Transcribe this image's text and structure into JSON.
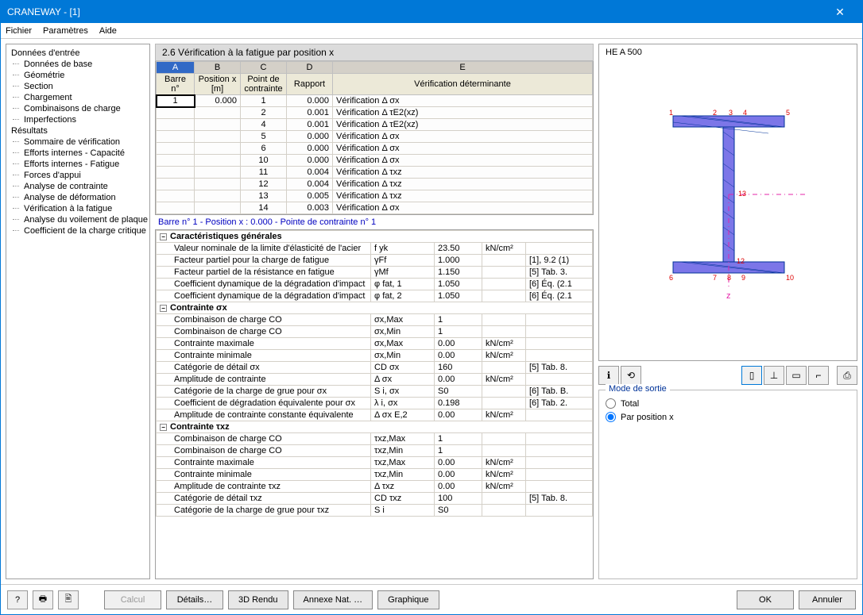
{
  "window_title": "CRANEWAY - [1]",
  "menu": {
    "file": "Fichier",
    "params": "Paramètres",
    "help": "Aide"
  },
  "sidebar": {
    "group1": "Données d'entrée",
    "items1": [
      "Données de base",
      "Géométrie",
      "Section",
      "Chargement",
      "Combinaisons de charge",
      "Imperfections"
    ],
    "group2": "Résultats",
    "items2": [
      "Sommaire de vérification",
      "Efforts internes - Capacité",
      "Efforts internes - Fatigue",
      "Forces d'appui",
      "Analyse de contrainte",
      "Analyse de déformation",
      "Vérification à la fatigue",
      "Analyse du voilement de plaque",
      "Coefficient de la charge critique"
    ]
  },
  "panel_title": "2.6 Vérification à la fatigue par position x",
  "headers": {
    "colA": "A",
    "colB": "B",
    "colC": "C",
    "colD": "D",
    "colE": "E",
    "barre": "Barre n°",
    "pos": "Position x [m]",
    "pt": "Point de contrainte",
    "ratio": "Rapport",
    "det": "Vérification déterminante"
  },
  "rows": [
    {
      "b": "1",
      "x": "0.000",
      "pt": "1",
      "r": "0.000",
      "d": "Vérification  Δ σx"
    },
    {
      "b": "",
      "x": "",
      "pt": "2",
      "r": "0.001",
      "d": "Vérification  Δ τE2(xz)"
    },
    {
      "b": "",
      "x": "",
      "pt": "4",
      "r": "0.001",
      "d": "Vérification  Δ τE2(xz)"
    },
    {
      "b": "",
      "x": "",
      "pt": "5",
      "r": "0.000",
      "d": "Vérification  Δ σx"
    },
    {
      "b": "",
      "x": "",
      "pt": "6",
      "r": "0.000",
      "d": "Vérification  Δ σx"
    },
    {
      "b": "",
      "x": "",
      "pt": "10",
      "r": "0.000",
      "d": "Vérification  Δ σx"
    },
    {
      "b": "",
      "x": "",
      "pt": "11",
      "r": "0.004",
      "d": "Vérification  Δ τxz"
    },
    {
      "b": "",
      "x": "",
      "pt": "12",
      "r": "0.004",
      "d": "Vérification  Δ τxz"
    },
    {
      "b": "",
      "x": "",
      "pt": "13",
      "r": "0.005",
      "d": "Vérification  Δ τxz"
    },
    {
      "b": "",
      "x": "",
      "pt": "14",
      "r": "0.003",
      "d": "Vérification  Δ σx"
    }
  ],
  "detail_label": "Barre n°  1  -  Position x :  0.000  -  Pointe de contrainte n°  1",
  "detail_groups": {
    "g1": "Caractéristiques générales",
    "g2": "Contrainte σx",
    "g3": "Contrainte τxz"
  },
  "details": [
    {
      "lbl": "Valeur nominale de la limite d'élasticité de l'acier",
      "sym": "f yk",
      "val": "23.50",
      "unit": "kN/cm²",
      "ref": ""
    },
    {
      "lbl": "Facteur partiel pour la charge de fatigue",
      "sym": "γFf",
      "val": "1.000",
      "unit": "",
      "ref": "[1], 9.2 (1)"
    },
    {
      "lbl": "Facteur partiel de la résistance en fatigue",
      "sym": "γMf",
      "val": "1.150",
      "unit": "",
      "ref": "[5] Tab. 3."
    },
    {
      "lbl": "Coefficient dynamique de la dégradation d'impact",
      "sym": "φ fat, 1",
      "val": "1.050",
      "unit": "",
      "ref": "[6] Éq. (2.1"
    },
    {
      "lbl": "Coefficient dynamique de la dégradation d'impact",
      "sym": "φ fat, 2",
      "val": "1.050",
      "unit": "",
      "ref": "[6] Éq. (2.1"
    }
  ],
  "details2": [
    {
      "lbl": "Combinaison de charge CO",
      "sym": "σx,Max",
      "val": "1",
      "unit": "",
      "ref": ""
    },
    {
      "lbl": "Combinaison de charge CO",
      "sym": "σx,Min",
      "val": "1",
      "unit": "",
      "ref": ""
    },
    {
      "lbl": "Contrainte maximale",
      "sym": "σx,Max",
      "val": "0.00",
      "unit": "kN/cm²",
      "ref": ""
    },
    {
      "lbl": "Contrainte minimale",
      "sym": "σx,Min",
      "val": "0.00",
      "unit": "kN/cm²",
      "ref": ""
    },
    {
      "lbl": "Catégorie de détail σx",
      "sym": "CD σx",
      "val": "160",
      "unit": "",
      "ref": "[5] Tab. 8."
    },
    {
      "lbl": "Amplitude de contrainte",
      "sym": "Δ σx",
      "val": "0.00",
      "unit": "kN/cm²",
      "ref": ""
    },
    {
      "lbl": "Catégorie de la charge de grue pour σx",
      "sym": "S i, σx",
      "val": "S0",
      "unit": "",
      "ref": "[6] Tab. B."
    },
    {
      "lbl": "Coefficient de dégradation équivalente pour σx",
      "sym": "λ i, σx",
      "val": "0.198",
      "unit": "",
      "ref": "[6] Tab. 2."
    },
    {
      "lbl": "Amplitude de contrainte constante équivalente",
      "sym": "Δ σx E,2",
      "val": "0.00",
      "unit": "kN/cm²",
      "ref": ""
    }
  ],
  "details3": [
    {
      "lbl": "Combinaison de charge CO",
      "sym": "τxz,Max",
      "val": "1",
      "unit": "",
      "ref": ""
    },
    {
      "lbl": "Combinaison de charge CO",
      "sym": "τxz,Min",
      "val": "1",
      "unit": "",
      "ref": ""
    },
    {
      "lbl": "Contrainte maximale",
      "sym": "τxz,Max",
      "val": "0.00",
      "unit": "kN/cm²",
      "ref": ""
    },
    {
      "lbl": "Contrainte minimale",
      "sym": "τxz,Min",
      "val": "0.00",
      "unit": "kN/cm²",
      "ref": ""
    },
    {
      "lbl": "Amplitude de contrainte τxz",
      "sym": "Δ τxz",
      "val": "0.00",
      "unit": "kN/cm²",
      "ref": ""
    },
    {
      "lbl": "Catégorie de détail τxz",
      "sym": "CD τxz",
      "val": "100",
      "unit": "",
      "ref": "[5] Tab. 8."
    },
    {
      "lbl": "Catégorie de la charge de grue pour τxz",
      "sym": "S i",
      "val": "S0",
      "unit": "",
      "ref": ""
    }
  ],
  "preview_title": "HE A 500",
  "output_mode": {
    "title": "Mode de sortie",
    "total": "Total",
    "bypos": "Par position x"
  },
  "buttons": {
    "calc": "Calcul",
    "details": "Détails…",
    "render": "3D Rendu",
    "annex": "Annexe Nat. …",
    "graph": "Graphique",
    "ok": "OK",
    "cancel": "Annuler"
  }
}
